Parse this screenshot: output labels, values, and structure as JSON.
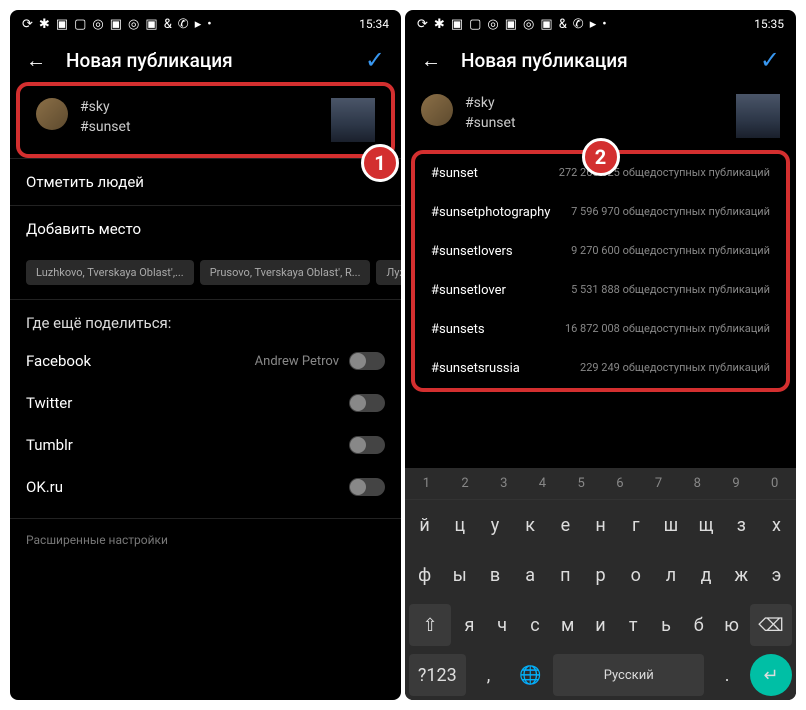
{
  "left": {
    "status_time": "15:34",
    "header_title": "Новая публикация",
    "caption_line1": "#sky",
    "caption_line2": "#sunset",
    "tag_people": "Отметить людей",
    "add_location": "Добавить место",
    "chips": [
      "Luzhkovo, Tverskaya Oblast',...",
      "Prusovo, Tverskaya Oblast', R...",
      "Лужков"
    ],
    "share_also": "Где ещё поделиться:",
    "fb": "Facebook",
    "fb_user": "Andrew Petrov",
    "tw": "Twitter",
    "tm": "Tumblr",
    "ok": "OK.ru",
    "advanced": "Расширенные настройки",
    "badge": "1"
  },
  "right": {
    "status_time": "15:35",
    "header_title": "Новая публикация",
    "caption_line1": "#sky",
    "caption_line2": "#sunset",
    "badge": "2",
    "suggestions": [
      {
        "tag": "#sunset",
        "count": "272 266 025 общедоступных публикаций"
      },
      {
        "tag": "#sunsetphotography",
        "count": "7 596 970 общедоступных публикаций"
      },
      {
        "tag": "#sunsetlovers",
        "count": "9 270 600 общедоступных публикаций"
      },
      {
        "tag": "#sunsetlover",
        "count": "5 531 888 общедоступных публикаций"
      },
      {
        "tag": "#sunsets",
        "count": "16 872 008 общедоступных публикаций"
      },
      {
        "tag": "#sunsetsrussia",
        "count": "229 249 общедоступных публикаций"
      }
    ],
    "kb_predict": [
      "1",
      "2",
      "3",
      "4",
      "5",
      "6",
      "7",
      "8",
      "9",
      "0"
    ],
    "kb_row1": [
      "й",
      "ц",
      "у",
      "к",
      "е",
      "н",
      "г",
      "ш",
      "щ",
      "з",
      "х"
    ],
    "kb_row2": [
      "ф",
      "ы",
      "в",
      "а",
      "п",
      "р",
      "о",
      "л",
      "д",
      "ж",
      "э"
    ],
    "kb_row3": [
      "я",
      "ч",
      "с",
      "м",
      "и",
      "т",
      "ь",
      "б",
      "ю"
    ],
    "kb_lang": "Русский",
    "kb_num": "?123"
  }
}
